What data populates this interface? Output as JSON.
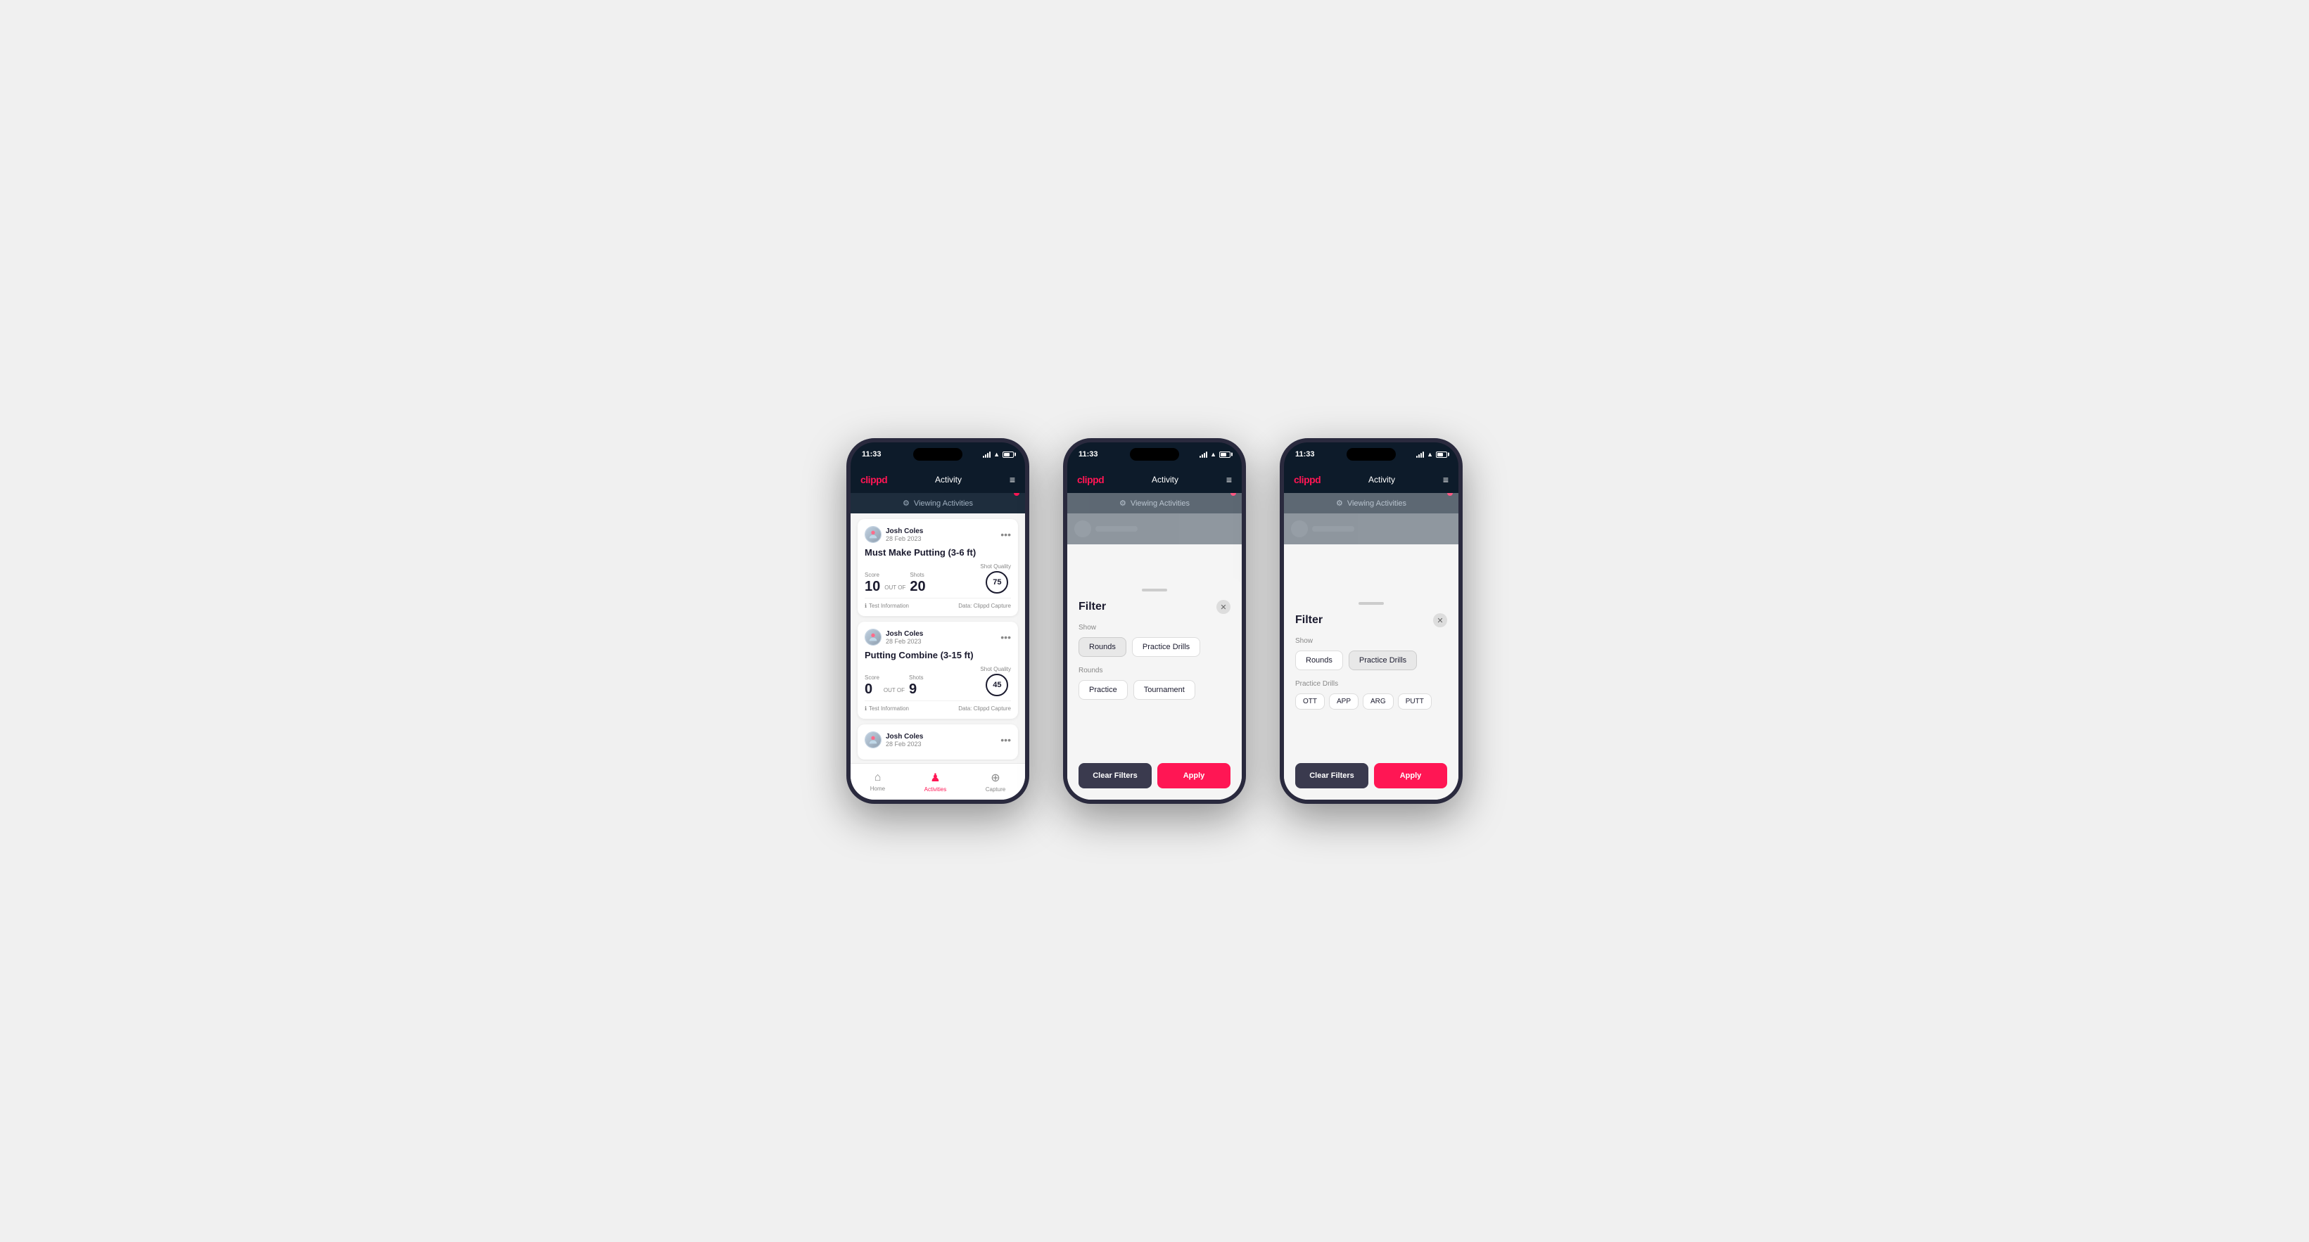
{
  "phone1": {
    "statusBar": {
      "time": "11:33",
      "battery": "31"
    },
    "header": {
      "logo": "clippd",
      "title": "Activity",
      "menuIcon": "≡"
    },
    "viewingBar": {
      "text": "Viewing Activities"
    },
    "cards": [
      {
        "userName": "Josh Coles",
        "userDate": "28 Feb 2023",
        "activityTitle": "Must Make Putting (3-6 ft)",
        "scoreLabel": "Score",
        "scoreValue": "10",
        "outOfLabel": "OUT OF",
        "shotsLabel": "Shots",
        "shotsValue": "20",
        "shotQualityLabel": "Shot Quality",
        "shotQualityValue": "75",
        "footerInfo": "Test Information",
        "footerData": "Data: Clippd Capture"
      },
      {
        "userName": "Josh Coles",
        "userDate": "28 Feb 2023",
        "activityTitle": "Putting Combine (3-15 ft)",
        "scoreLabel": "Score",
        "scoreValue": "0",
        "outOfLabel": "OUT OF",
        "shotsLabel": "Shots",
        "shotsValue": "9",
        "shotQualityLabel": "Shot Quality",
        "shotQualityValue": "45",
        "footerInfo": "Test Information",
        "footerData": "Data: Clippd Capture"
      },
      {
        "userName": "Josh Coles",
        "userDate": "28 Feb 2023",
        "activityTitle": "",
        "scoreLabel": "",
        "scoreValue": "",
        "outOfLabel": "",
        "shotsLabel": "",
        "shotsValue": "",
        "shotQualityLabel": "",
        "shotQualityValue": "",
        "footerInfo": "",
        "footerData": ""
      }
    ],
    "bottomNav": {
      "homeLabel": "Home",
      "activitiesLabel": "Activities",
      "captureLabel": "Capture"
    }
  },
  "phone2": {
    "statusBar": {
      "time": "11:33",
      "battery": "31"
    },
    "header": {
      "logo": "clippd",
      "title": "Activity",
      "menuIcon": "≡"
    },
    "viewingBar": {
      "text": "Viewing Activities"
    },
    "filter": {
      "title": "Filter",
      "showLabel": "Show",
      "roundsBtn": "Rounds",
      "practiceDrillsBtn": "Practice Drills",
      "roundsLabel": "Rounds",
      "practiceBtn": "Practice",
      "tournamentBtn": "Tournament",
      "clearFiltersBtn": "Clear Filters",
      "applyBtn": "Apply"
    }
  },
  "phone3": {
    "statusBar": {
      "time": "11:33",
      "battery": "31"
    },
    "header": {
      "logo": "clippd",
      "title": "Activity",
      "menuIcon": "≡"
    },
    "viewingBar": {
      "text": "Viewing Activities"
    },
    "filter": {
      "title": "Filter",
      "showLabel": "Show",
      "roundsBtn": "Rounds",
      "practiceDrillsBtn": "Practice Drills",
      "practiceDrillsLabel": "Practice Drills",
      "ottBtn": "OTT",
      "appBtn": "APP",
      "argBtn": "ARG",
      "puttBtn": "PUTT",
      "clearFiltersBtn": "Clear Filters",
      "applyBtn": "Apply"
    }
  }
}
